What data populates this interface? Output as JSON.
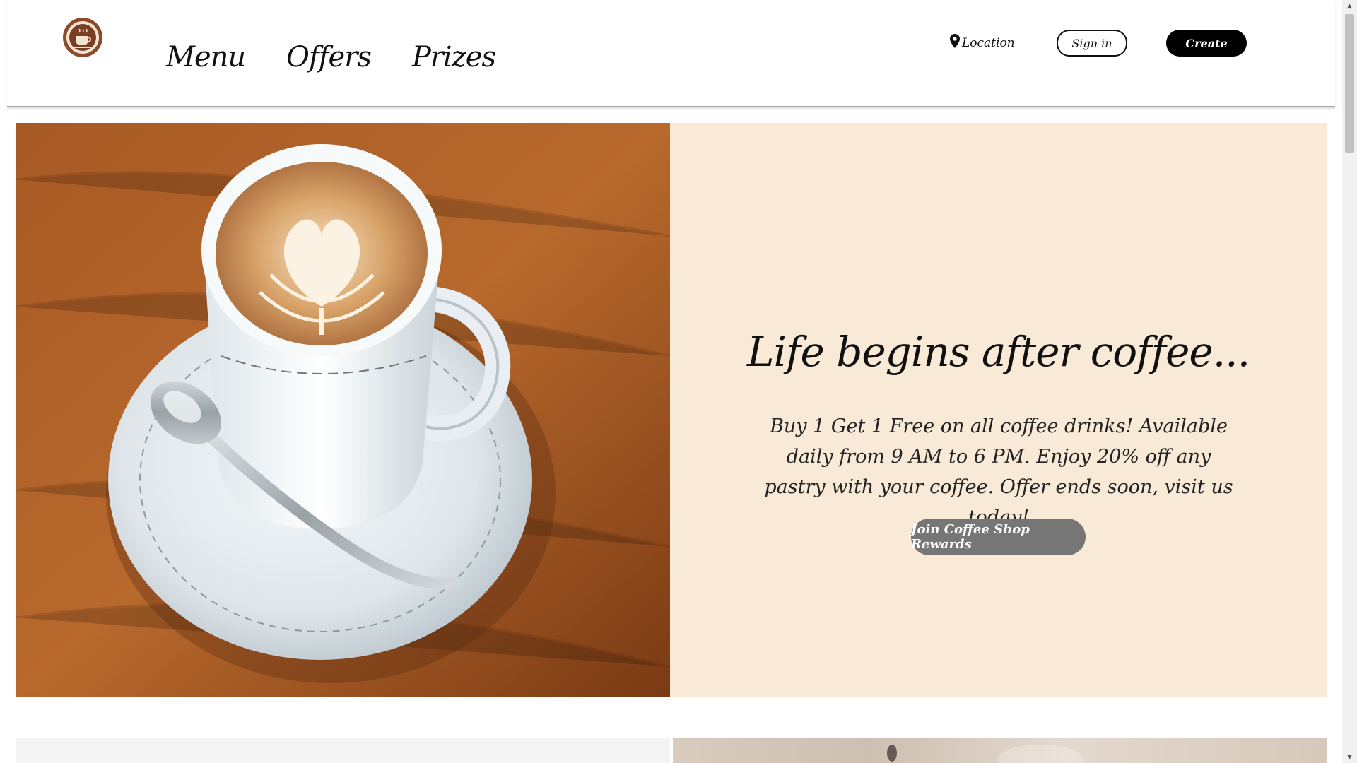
{
  "header": {
    "logo_alt": "Coffee Shop logo",
    "nav": [
      {
        "label": "Menu"
      },
      {
        "label": "Offers"
      },
      {
        "label": "Prizes"
      }
    ],
    "location_label": "Location",
    "signin_label": "Sign in",
    "create_label": "Create"
  },
  "hero": {
    "title": "Life begins after coffee...",
    "body": "Buy 1 Get 1 Free on all coffee drinks! Available daily from 9 AM to 6 PM. Enjoy 20% off any pastry with your coffee. Offer ends soon, visit us today!",
    "cta_label": "Join Coffee Shop Rewards",
    "panel_color": "#f9ead8",
    "cta_color": "#767676"
  },
  "icons": {
    "location": "map-pin-icon",
    "logo": "coffee-badge-icon"
  }
}
